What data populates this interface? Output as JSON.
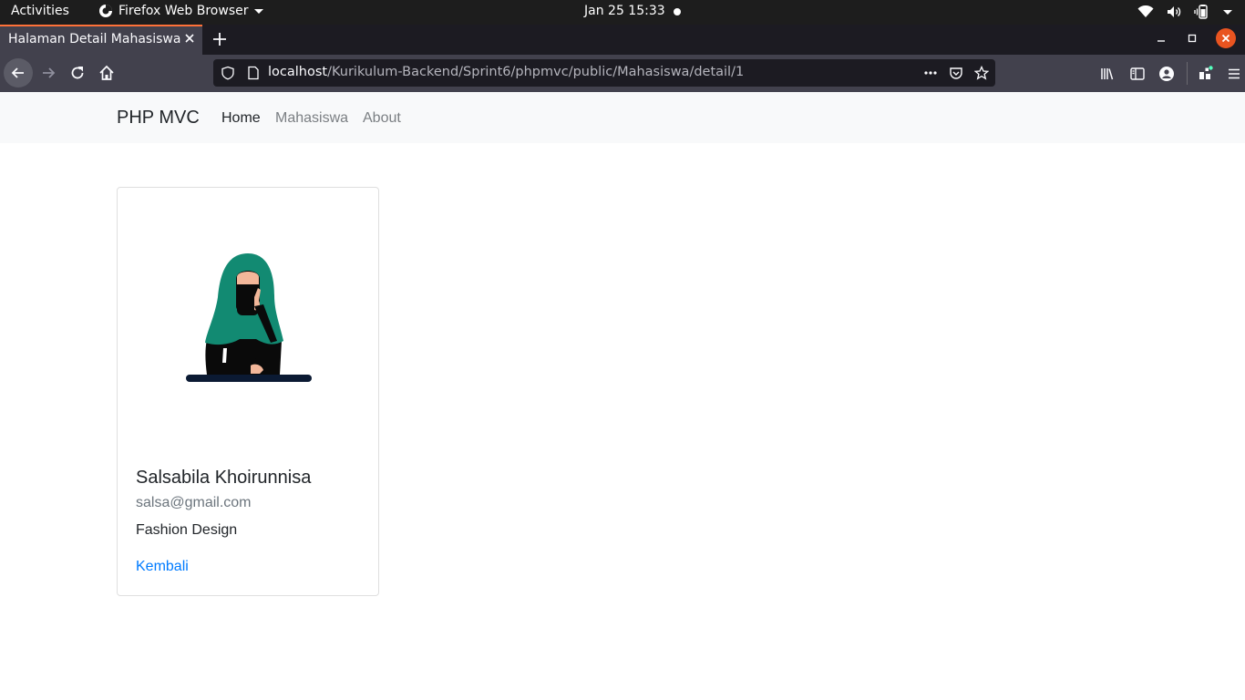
{
  "system_bar": {
    "activities": "Activities",
    "app_name": "Firefox Web Browser",
    "clock": "Jan 25  15:33"
  },
  "browser": {
    "tab": {
      "title": "Halaman Detail Mahasiswa"
    },
    "url": {
      "host": "localhost",
      "path": "/Kurikulum-Backend/Sprint6/phpmvc/public/Mahasiswa/detail/1"
    },
    "icons": {
      "back": "back-arrow-icon",
      "forward": "forward-arrow-icon",
      "reload": "reload-icon",
      "home": "home-icon",
      "library": "library-icon",
      "sidebar": "sidebar-icon",
      "account": "account-icon",
      "extensions": "extensions-icon",
      "menu": "hamburger-menu-icon"
    },
    "accent_color": "#ff7139"
  },
  "site": {
    "brand": "PHP MVC",
    "nav": [
      {
        "label": "Home",
        "active": true
      },
      {
        "label": "Mahasiswa",
        "active": false
      },
      {
        "label": "About",
        "active": false
      }
    ]
  },
  "student_card": {
    "name": "Salsabila Khoirunnisa",
    "email": "salsa@gmail.com",
    "major": "Fashion Design",
    "back_link": "Kembali",
    "illustration": "woman-in-green-hijab-thinking-illustration",
    "link_color": "#007bff"
  }
}
